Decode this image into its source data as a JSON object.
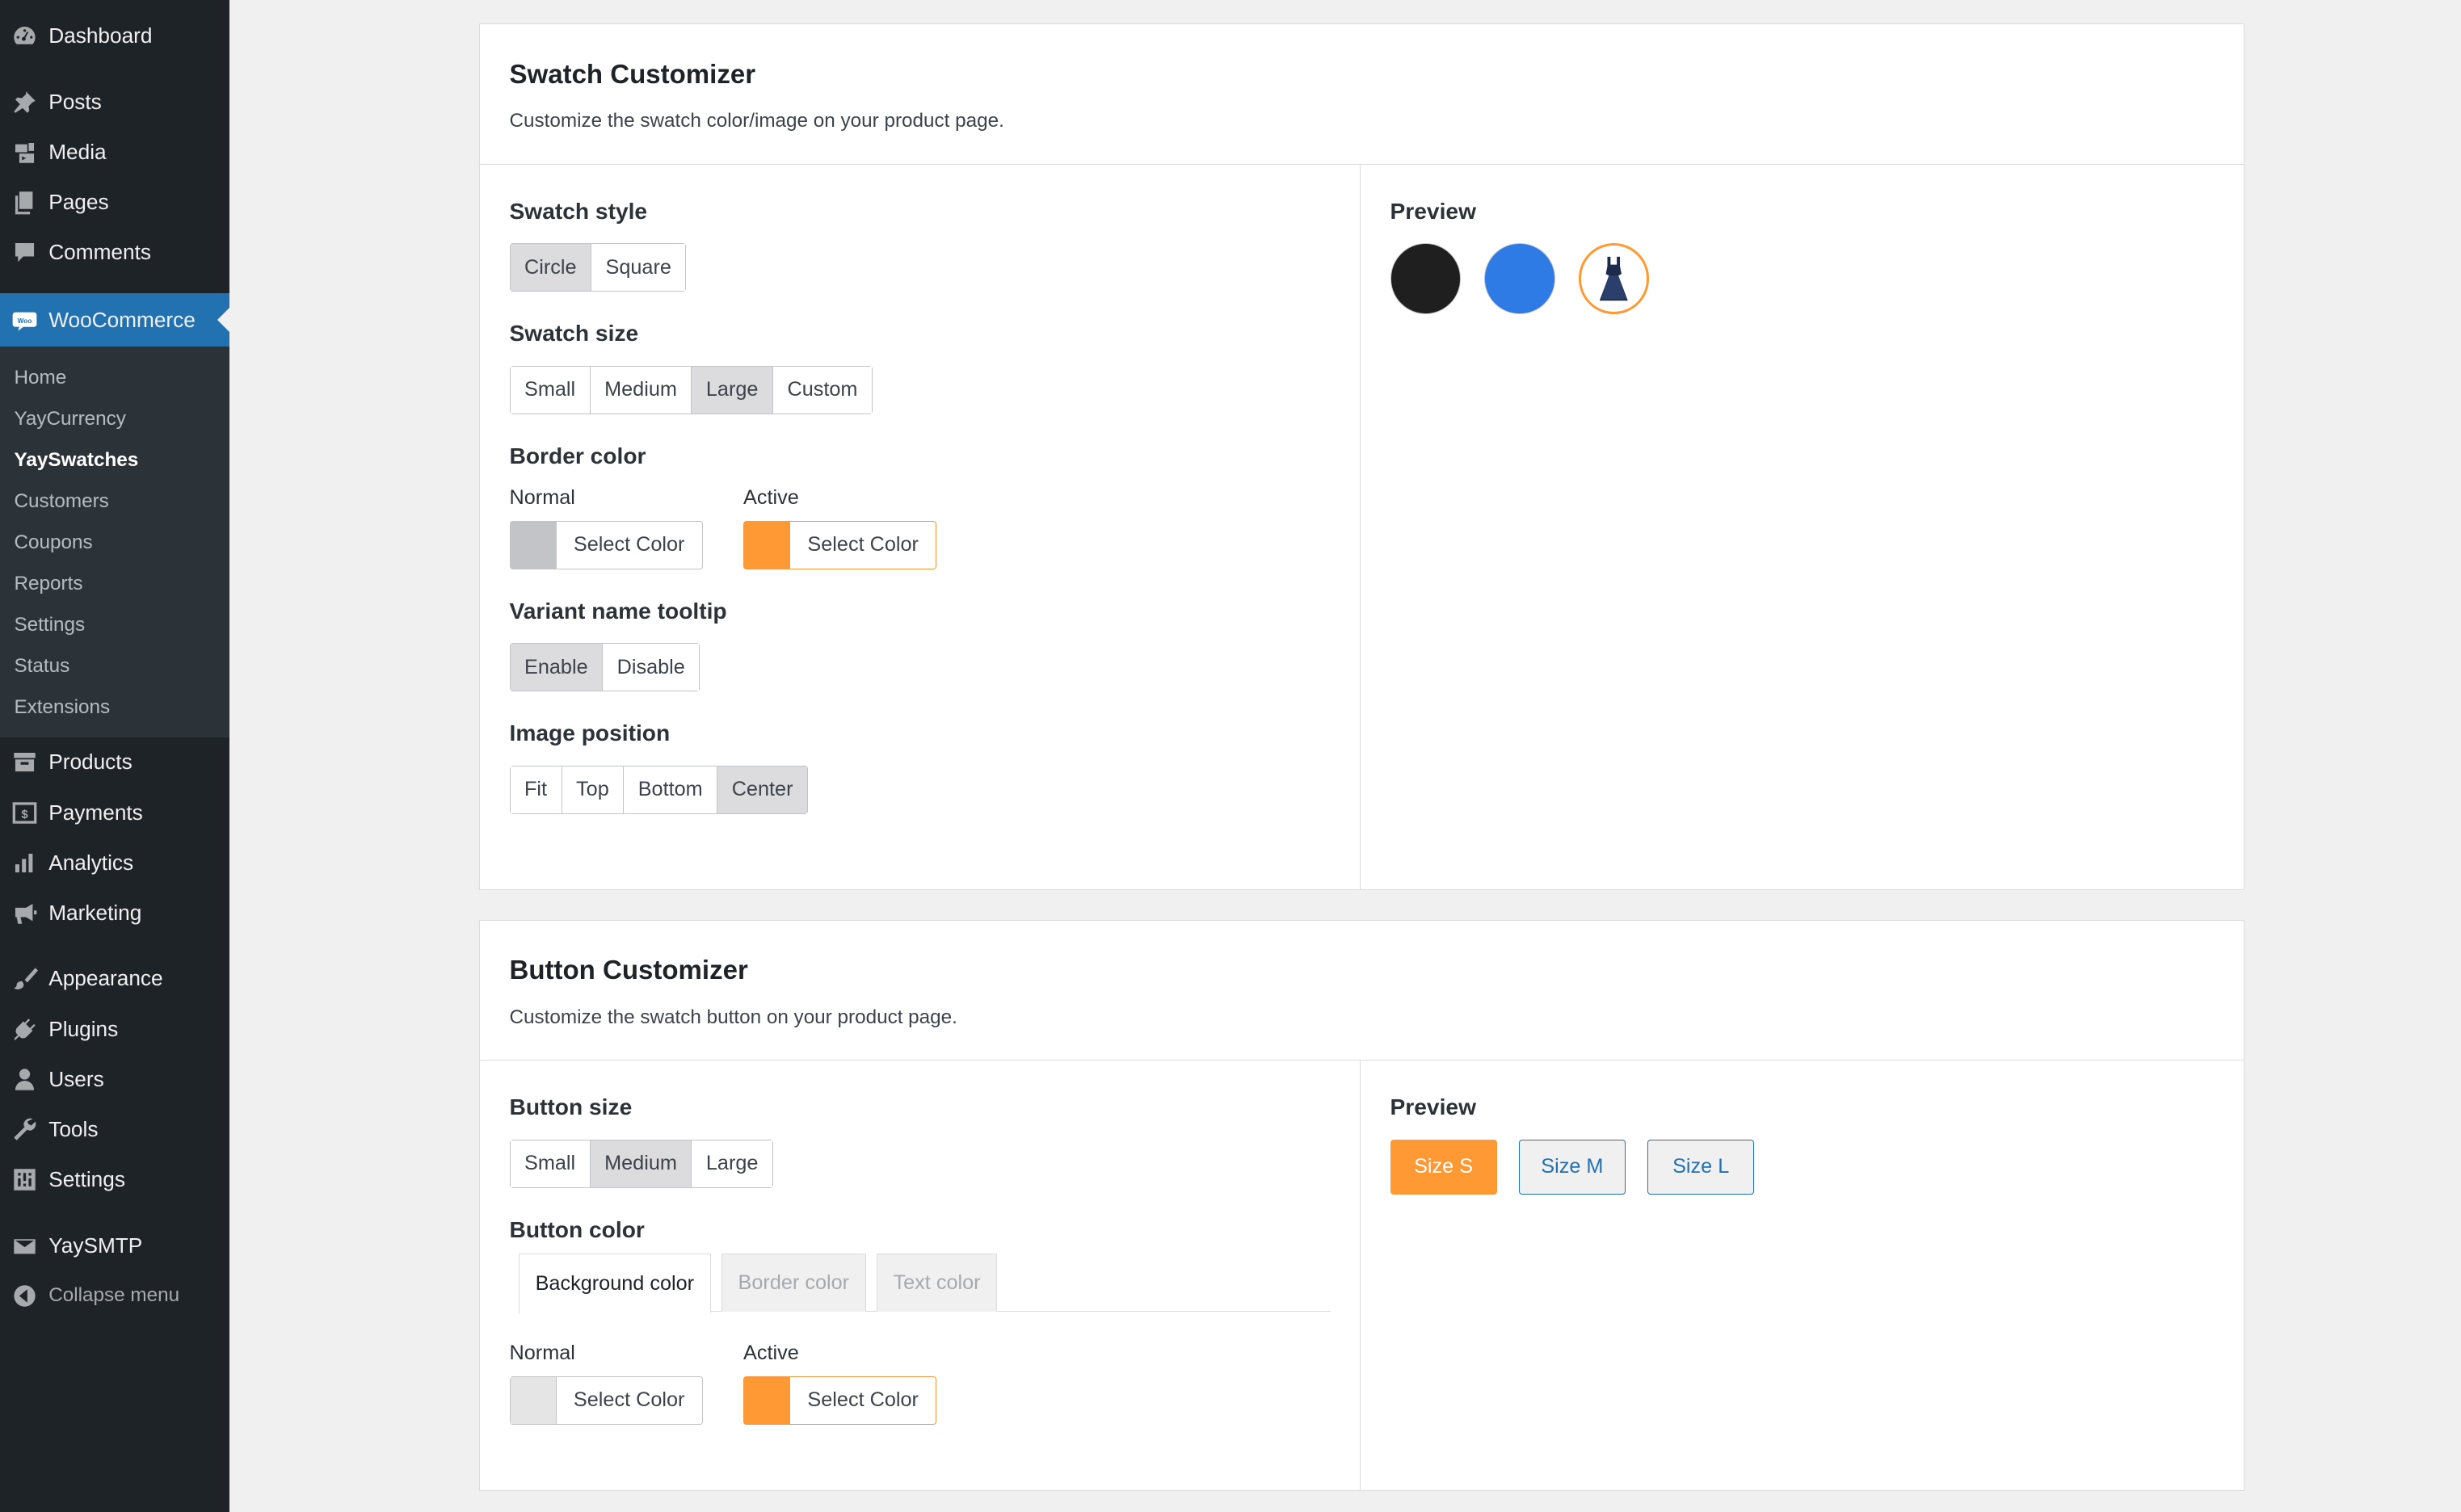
{
  "sidebar": {
    "items_top": [
      {
        "label": "Dashboard",
        "icon": "dashboard-icon"
      },
      {
        "label": "Posts",
        "icon": "pin-icon"
      },
      {
        "label": "Media",
        "icon": "media-icon"
      },
      {
        "label": "Pages",
        "icon": "pages-icon"
      },
      {
        "label": "Comments",
        "icon": "comment-icon"
      }
    ],
    "woocommerce": {
      "label": "WooCommerce",
      "icon": "woo-icon"
    },
    "submenu": [
      "Home",
      "YayCurrency",
      "YaySwatches",
      "Customers",
      "Coupons",
      "Reports",
      "Settings",
      "Status",
      "Extensions"
    ],
    "items_mid": [
      {
        "label": "Products",
        "icon": "archive-icon"
      },
      {
        "label": "Payments",
        "icon": "dollar-icon"
      },
      {
        "label": "Analytics",
        "icon": "chart-icon"
      },
      {
        "label": "Marketing",
        "icon": "megaphone-icon"
      }
    ],
    "items_bottom": [
      {
        "label": "Appearance",
        "icon": "brush-icon"
      },
      {
        "label": "Plugins",
        "icon": "plugin-icon"
      },
      {
        "label": "Users",
        "icon": "user-icon"
      },
      {
        "label": "Tools",
        "icon": "wrench-icon"
      },
      {
        "label": "Settings",
        "icon": "sliders-icon"
      }
    ],
    "yaysmtp": {
      "label": "YaySMTP",
      "icon": "envelope-icon"
    },
    "collapse": {
      "label": "Collapse menu",
      "icon": "collapse-arrow-icon"
    }
  },
  "swatch": {
    "title": "Swatch Customizer",
    "desc": "Customize the swatch color/image on your product page.",
    "style": {
      "label": "Swatch style",
      "options": [
        "Circle",
        "Square"
      ],
      "selected": "Circle"
    },
    "size": {
      "label": "Swatch size",
      "options": [
        "Small",
        "Medium",
        "Large",
        "Custom"
      ],
      "selected": "Large"
    },
    "border": {
      "label": "Border color",
      "normal_label": "Normal",
      "normal_color": "#c3c4c7",
      "active_label": "Active",
      "active_color": "#ff9933",
      "button_label": "Select Color"
    },
    "tooltip": {
      "label": "Variant name tooltip",
      "options": [
        "Enable",
        "Disable"
      ],
      "selected": "Enable"
    },
    "position": {
      "label": "Image position",
      "options": [
        "Fit",
        "Top",
        "Bottom",
        "Center"
      ],
      "selected": "Center"
    },
    "preview_title": "Preview",
    "preview_colors": [
      "#1f1f1f",
      "#2f7be6"
    ],
    "preview_image_icon": "dress-icon"
  },
  "button": {
    "title": "Button Customizer",
    "desc": "Customize the swatch button on your product page.",
    "size": {
      "label": "Button size",
      "options": [
        "Small",
        "Medium",
        "Large"
      ],
      "selected": "Medium"
    },
    "color_label": "Button color",
    "tabs": [
      "Background color",
      "Border color",
      "Text color"
    ],
    "active_tab": "Background color",
    "normal_label": "Normal",
    "normal_color": "#e5e5e5",
    "active_label": "Active",
    "active_color": "#ff9933",
    "button_label": "Select Color",
    "preview_title": "Preview",
    "preview_buttons": [
      "Size S",
      "Size M",
      "Size L"
    ],
    "preview_active": "Size S"
  }
}
